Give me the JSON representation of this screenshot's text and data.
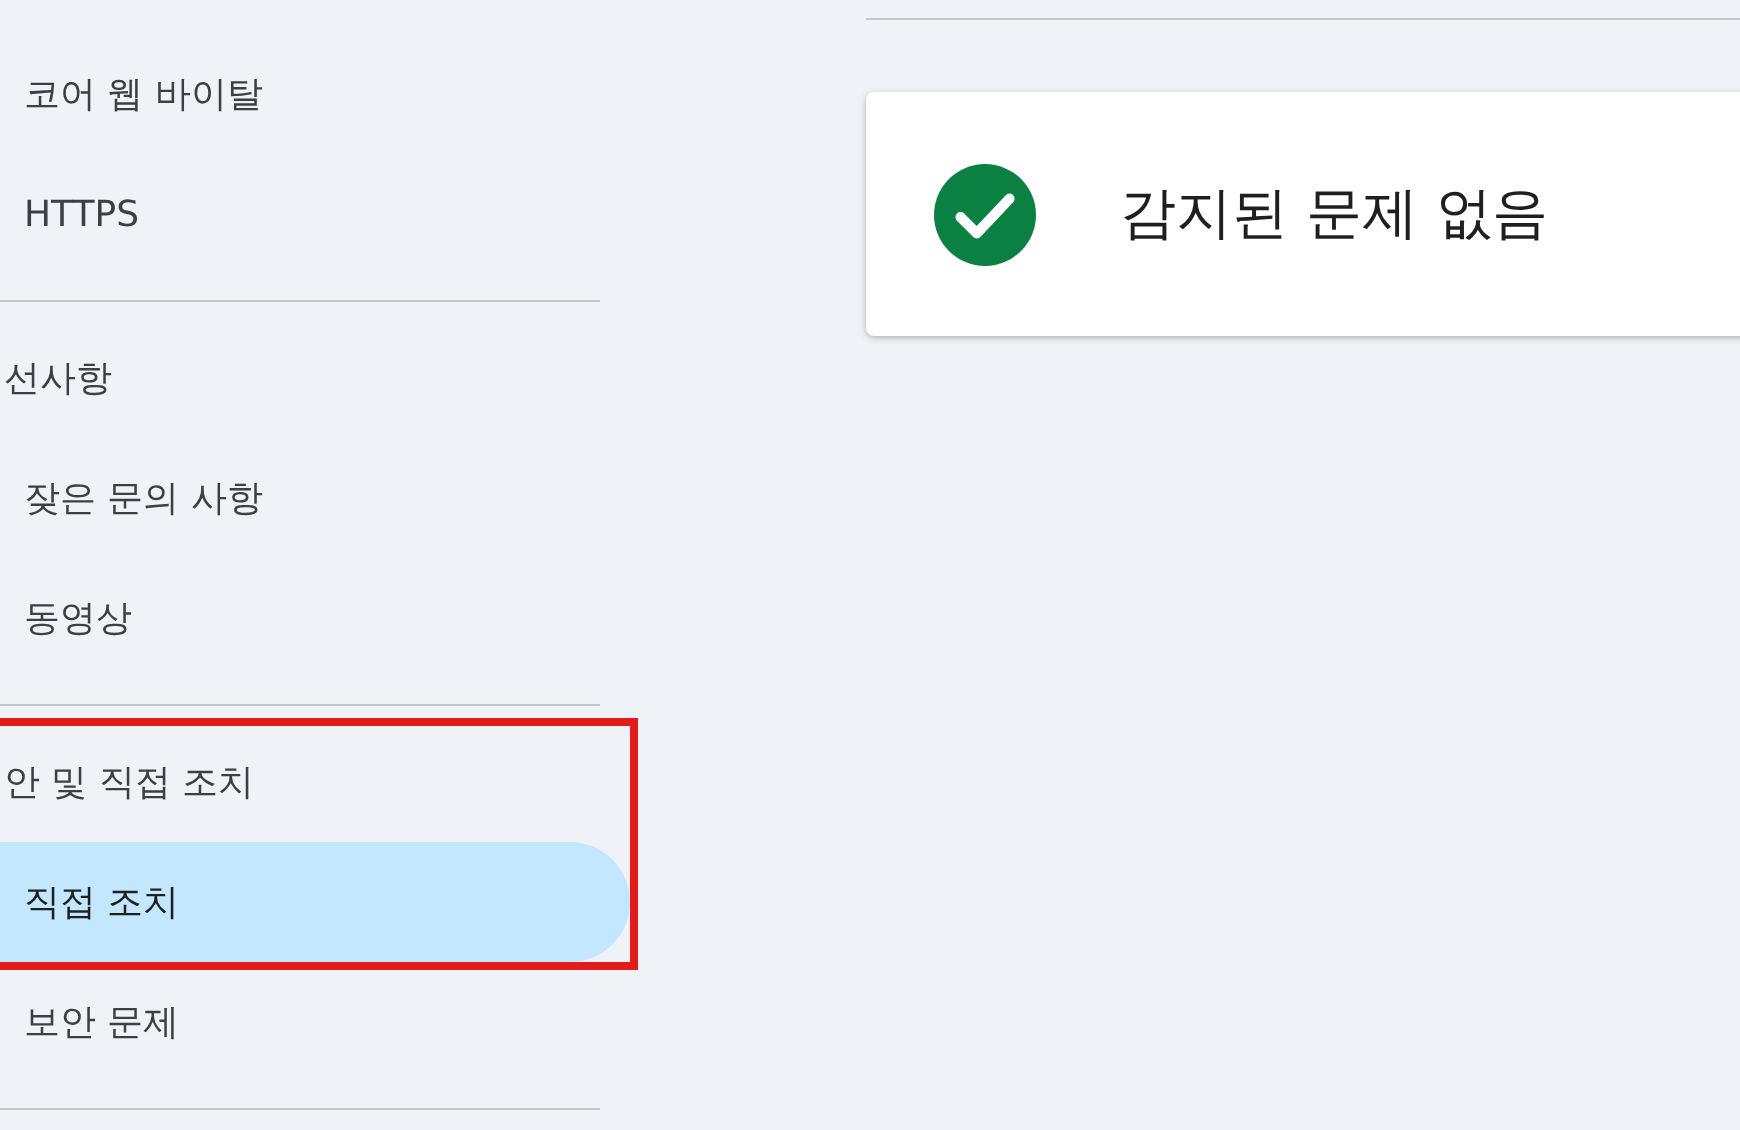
{
  "sidebar": {
    "sections": [
      {
        "items": [
          {
            "label": "코어 웹 바이탈",
            "selected": false,
            "highlighted": false
          },
          {
            "label": "HTTPS",
            "selected": false,
            "highlighted": false
          }
        ]
      },
      {
        "header": {
          "label": "선사항",
          "highlighted": false
        },
        "items": [
          {
            "label": "잦은 문의 사항",
            "selected": false,
            "highlighted": false
          },
          {
            "label": "동영상",
            "selected": false,
            "highlighted": false
          }
        ]
      },
      {
        "header": {
          "label": "안 및 직접 조치",
          "highlighted": true
        },
        "items": [
          {
            "label": "직접 조치",
            "selected": true,
            "highlighted": true
          },
          {
            "label": "보안 문제",
            "selected": false,
            "highlighted": false
          }
        ]
      }
    ]
  },
  "status_card": {
    "kind": "success",
    "message": "감지된 문제 없음"
  }
}
